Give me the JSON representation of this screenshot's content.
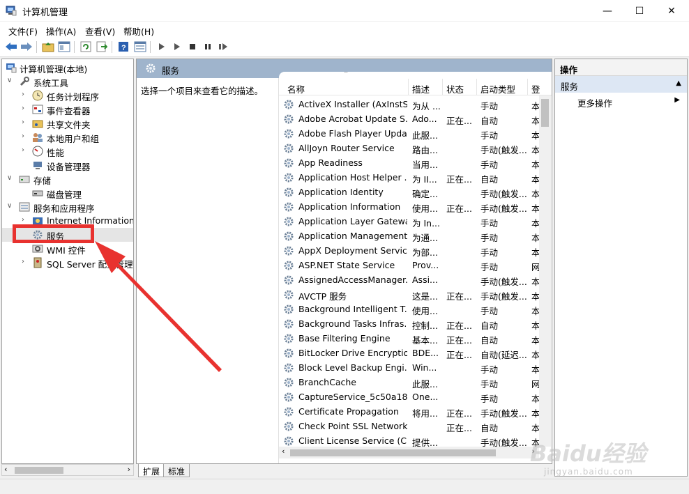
{
  "window": {
    "title": "计算机管理"
  },
  "menu": [
    "文件(F)",
    "操作(A)",
    "查看(V)",
    "帮助(H)"
  ],
  "tree": {
    "root": "计算机管理(本地)",
    "items": [
      {
        "label": "系统工具",
        "level": 1,
        "expander": "down"
      },
      {
        "label": "任务计划程序",
        "level": 2,
        "expander": "right"
      },
      {
        "label": "事件查看器",
        "level": 2,
        "expander": "right"
      },
      {
        "label": "共享文件夹",
        "level": 2,
        "expander": "right"
      },
      {
        "label": "本地用户和组",
        "level": 2,
        "expander": "right"
      },
      {
        "label": "性能",
        "level": 2,
        "expander": "right"
      },
      {
        "label": "设备管理器",
        "level": 2,
        "expander": ""
      },
      {
        "label": "存储",
        "level": 1,
        "expander": "down"
      },
      {
        "label": "磁盘管理",
        "level": 2,
        "expander": ""
      },
      {
        "label": "服务和应用程序",
        "level": 1,
        "expander": "down"
      },
      {
        "label": "Internet Information S",
        "level": 2,
        "expander": "right"
      },
      {
        "label": "服务",
        "level": 2,
        "expander": ""
      },
      {
        "label": "WMI 控件",
        "level": 2,
        "expander": ""
      },
      {
        "label": "SQL Server 配置管理器",
        "level": 2,
        "expander": "right"
      }
    ]
  },
  "panel": {
    "header": "服务",
    "description": "选择一个项目来查看它的描述。",
    "columns": [
      "名称",
      "描述",
      "状态",
      "启动类型",
      "登"
    ]
  },
  "services": [
    [
      "ActiveX Installer (AxInstSV)",
      "为从 ...",
      "",
      "手动",
      "本"
    ],
    [
      "Adobe Acrobat Update S...",
      "Ado...",
      "正在...",
      "自动",
      "本"
    ],
    [
      "Adobe Flash Player Upda...",
      "此服...",
      "",
      "手动",
      "本"
    ],
    [
      "AllJoyn Router Service",
      "路由...",
      "",
      "手动(触发...",
      "本"
    ],
    [
      "App Readiness",
      "当用...",
      "",
      "手动",
      "本"
    ],
    [
      "Application Host Helper ...",
      "为 II...",
      "正在...",
      "自动",
      "本"
    ],
    [
      "Application Identity",
      "确定...",
      "",
      "手动(触发...",
      "本"
    ],
    [
      "Application Information",
      "使用...",
      "正在...",
      "手动(触发...",
      "本"
    ],
    [
      "Application Layer Gatewa...",
      "为 In...",
      "",
      "手动",
      "本"
    ],
    [
      "Application Management",
      "为通...",
      "",
      "手动",
      "本"
    ],
    [
      "AppX Deployment Servic...",
      "为部...",
      "",
      "手动",
      "本"
    ],
    [
      "ASP.NET State Service",
      "Prov...",
      "",
      "手动",
      "网"
    ],
    [
      "AssignedAccessManager...",
      "Assi...",
      "",
      "手动(触发...",
      "本"
    ],
    [
      "AVCTP 服务",
      "这是...",
      "正在...",
      "手动(触发...",
      "本"
    ],
    [
      "Background Intelligent T...",
      "使用...",
      "",
      "手动",
      "本"
    ],
    [
      "Background Tasks Infras...",
      "控制...",
      "正在...",
      "自动",
      "本"
    ],
    [
      "Base Filtering Engine",
      "基本...",
      "正在...",
      "自动",
      "本"
    ],
    [
      "BitLocker Drive Encryptio...",
      "BDE...",
      "正在...",
      "自动(延迟...",
      "本"
    ],
    [
      "Block Level Backup Engi...",
      "Win...",
      "",
      "手动",
      "本"
    ],
    [
      "BranchCache",
      "此服...",
      "",
      "手动",
      "网"
    ],
    [
      "CaptureService_5c50a18",
      "One...",
      "",
      "手动",
      "本"
    ],
    [
      "Certificate Propagation",
      "将用...",
      "正在...",
      "手动(触发...",
      "本"
    ],
    [
      "Check Point SSL Network...",
      "",
      "正在...",
      "自动",
      "本"
    ],
    [
      "Client License Service (Cli...",
      "提供...",
      "",
      "手动(触发...",
      "本"
    ]
  ],
  "tabs": [
    "扩展",
    "标准"
  ],
  "actions": {
    "title": "操作",
    "section": "服务",
    "more": "更多操作"
  },
  "watermark": {
    "logo": "Baidu经验",
    "url": "jingyan.baidu.com"
  },
  "colors": {
    "highlight": "#e8322f",
    "header": "#9fb4cc"
  }
}
